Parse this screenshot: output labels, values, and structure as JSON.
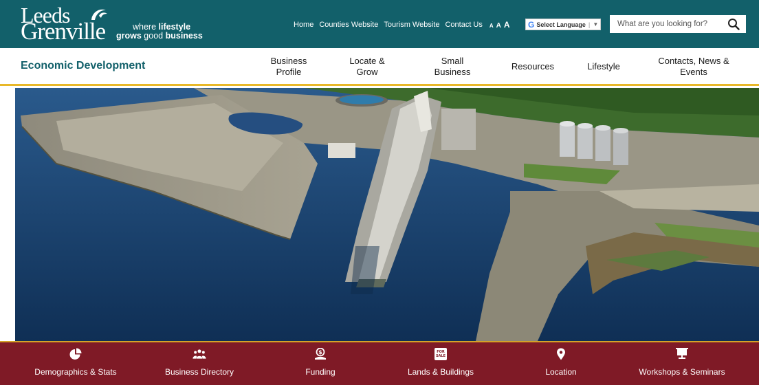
{
  "header": {
    "logo": {
      "word1": "Leeds",
      "word2": "Grenville"
    },
    "tagline": {
      "where": "where",
      "lifestyle": "lifestyle",
      "grows": "grows",
      "good": "good",
      "business": "business"
    },
    "utility_links": [
      "Home",
      "Counties Website",
      "Tourism Website",
      "Contact Us"
    ],
    "font_sizer": [
      "A",
      "A",
      "A"
    ],
    "translate": {
      "g": "G",
      "label": "Select Language",
      "caret": "▼"
    },
    "search": {
      "placeholder": "What are you looking for?",
      "value": "",
      "icon": "search-icon"
    }
  },
  "nav": {
    "section_title": "Economic Development",
    "items": [
      {
        "label_line1": "Business",
        "label_line2": "Profile"
      },
      {
        "label_line1": "Locate &",
        "label_line2": "Grow"
      },
      {
        "label_line1": "Small",
        "label_line2": "Business"
      },
      {
        "label_line1": "Resources",
        "label_line2": ""
      },
      {
        "label_line1": "Lifestyle",
        "label_line2": ""
      },
      {
        "label_line1": "Contacts, News &",
        "label_line2": "Events"
      }
    ]
  },
  "hero": {
    "image": "aerial-port-grain-elevator"
  },
  "quick_links": [
    {
      "label": "Demographics & Stats",
      "icon": "pie-chart-icon"
    },
    {
      "label": "Business Directory",
      "icon": "people-icon"
    },
    {
      "label": "Funding",
      "icon": "money-hand-icon"
    },
    {
      "label": "Lands & Buildings",
      "icon": "for-sale-sign-icon",
      "sign_text": "FOR SALE"
    },
    {
      "label": "Location",
      "icon": "map-pin-icon"
    },
    {
      "label": "Workshops & Seminars",
      "icon": "presentation-board-icon"
    }
  ],
  "colors": {
    "header_bg": "#12606a",
    "accent_gold": "#e8b829",
    "quickbar_bg": "#7f1a26",
    "title_teal": "#12606a"
  }
}
